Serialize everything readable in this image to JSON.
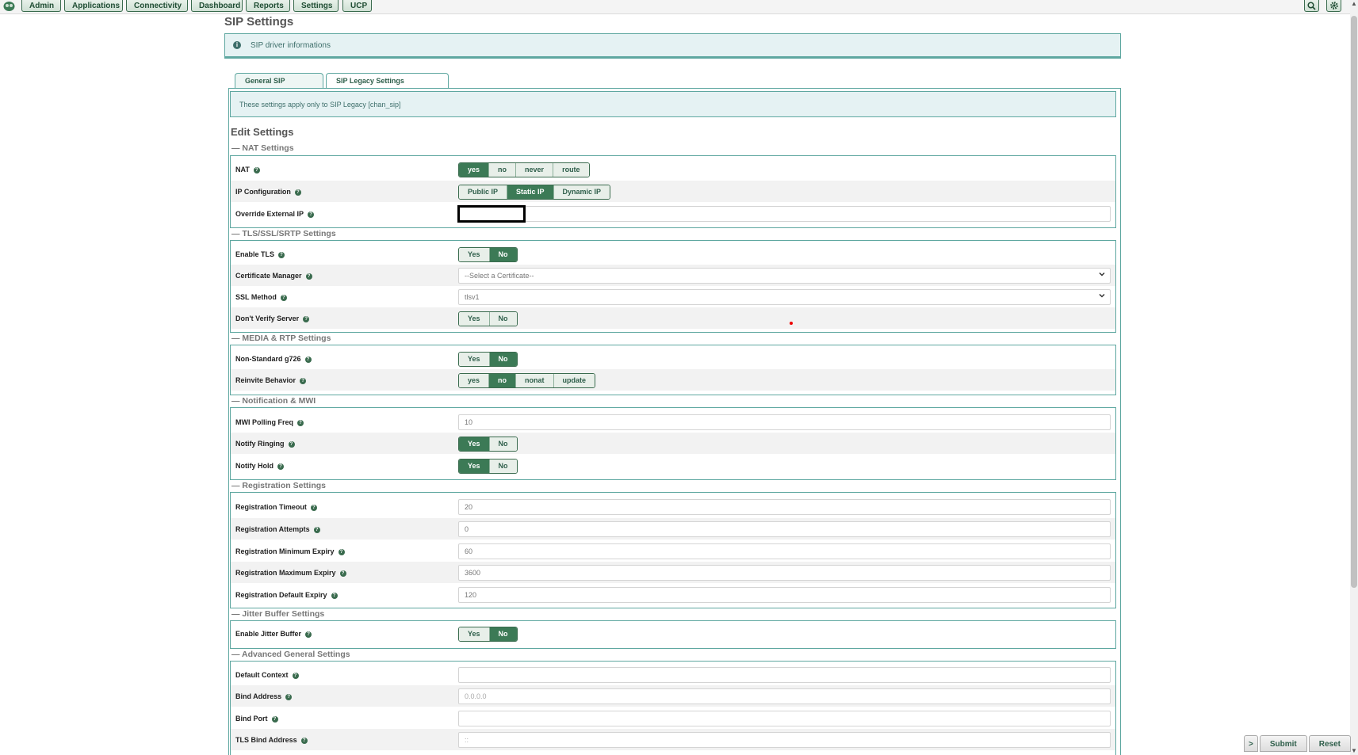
{
  "nav": {
    "items": [
      "Admin",
      "Applications",
      "Connectivity",
      "Dashboard",
      "Reports",
      "Settings",
      "UCP"
    ],
    "logo_icon": "freepbx-logo-icon",
    "right_icons": [
      "search-icon",
      "gear-icon"
    ]
  },
  "page_title": "SIP Settings",
  "info_banner": "SIP driver informations",
  "tabs": {
    "general": "General SIP Settings",
    "legacy": "SIP Legacy Settings [chan_sip]",
    "active": "legacy"
  },
  "legacy_note": "These settings apply only to SIP Legacy [chan_sip]",
  "edit_title": "Edit Settings",
  "sections": {
    "nat": "NAT Settings",
    "tls": "TLS/SSL/SRTP Settings",
    "media": "MEDIA & RTP Settings",
    "notify": "Notification & MWI",
    "reg": "Registration Settings",
    "jitter": "Jitter Buffer Settings",
    "adv": "Advanced General Settings"
  },
  "fields": {
    "nat": {
      "label": "NAT",
      "options": [
        "yes",
        "no",
        "never",
        "route"
      ],
      "selected": "yes"
    },
    "ipconfig": {
      "label": "IP Configuration",
      "options": [
        "Public IP",
        "Static IP",
        "Dynamic IP"
      ],
      "selected": "Static IP"
    },
    "override_ip": {
      "label": "Override External IP",
      "value": ""
    },
    "enable_tls": {
      "label": "Enable TLS",
      "options": [
        "Yes",
        "No"
      ],
      "selected": "No"
    },
    "cert_manager": {
      "label": "Certificate Manager",
      "value": "--Select a Certificate--"
    },
    "ssl_method": {
      "label": "SSL Method",
      "value": "tlsv1"
    },
    "dont_verify": {
      "label": "Don't Verify Server",
      "options": [
        "Yes",
        "No"
      ],
      "selected": ""
    },
    "g726": {
      "label": "Non-Standard g726",
      "options": [
        "Yes",
        "No"
      ],
      "selected": "No"
    },
    "reinvite": {
      "label": "Reinvite Behavior",
      "options": [
        "yes",
        "no",
        "nonat",
        "update"
      ],
      "selected": "no"
    },
    "mwi_freq": {
      "label": "MWI Polling Freq",
      "value": "10"
    },
    "notify_ringing": {
      "label": "Notify Ringing",
      "options": [
        "Yes",
        "No"
      ],
      "selected": "Yes"
    },
    "notify_hold": {
      "label": "Notify Hold",
      "options": [
        "Yes",
        "No"
      ],
      "selected": "Yes"
    },
    "reg_timeout": {
      "label": "Registration Timeout",
      "value": "20"
    },
    "reg_attempts": {
      "label": "Registration Attempts",
      "value": "0"
    },
    "reg_min": {
      "label": "Registration Minimum Expiry",
      "value": "60"
    },
    "reg_max": {
      "label": "Registration Maximum Expiry",
      "value": "3600"
    },
    "reg_default": {
      "label": "Registration Default Expiry",
      "value": "120"
    },
    "jitter": {
      "label": "Enable Jitter Buffer",
      "options": [
        "Yes",
        "No"
      ],
      "selected": "No"
    },
    "default_context": {
      "label": "Default Context",
      "value": ""
    },
    "bind_address": {
      "label": "Bind Address",
      "value": "0.0.0.0"
    },
    "bind_port": {
      "label": "Bind Port",
      "value": ""
    },
    "tls_bind": {
      "label": "TLS Bind Address",
      "value": "::"
    }
  },
  "footer": {
    "toggle": ">",
    "submit": "Submit",
    "reset": "Reset"
  },
  "colors": {
    "accent": "#3c7a56",
    "info_bg": "#e5f2f3",
    "info_border": "#5ea7a0"
  }
}
